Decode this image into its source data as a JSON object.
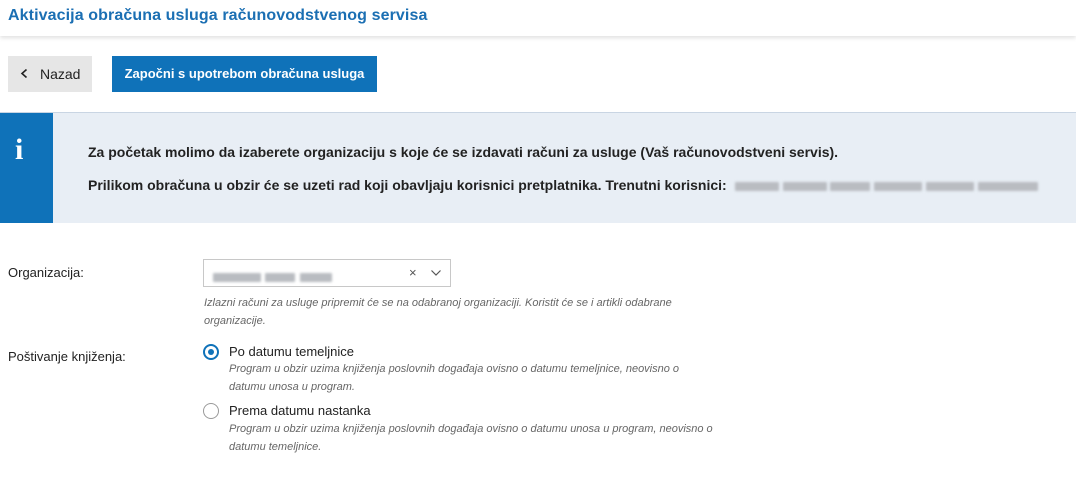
{
  "header": {
    "title": "Aktivacija obračuna usluga računovodstvenog servisa"
  },
  "toolbar": {
    "back_label": "Nazad",
    "start_label": "Započni s upotrebom obračuna usluga"
  },
  "info": {
    "icon": "info-icon",
    "glyph": "i",
    "line1": "Za početak molimo da izaberete organizaciju s koje će se izdavati računi za usluge (Vaš računovodstveni servis).",
    "line2_prefix": "Prilikom obračuna u obzir će se uzeti rad koji obavljaju korisnici pretplatnika. Trenutni korisnici:"
  },
  "form": {
    "organization_label": "Organizacija:",
    "organization_hint": "Izlazni računi za usluge pripremit će se na odabranoj organizaciji. Koristit će se i artikli odabrane organizacije.",
    "clear_glyph": "×",
    "posting_label": "Poštivanje knjiženja:",
    "options": [
      {
        "label": "Po datumu temeljnice",
        "hint": "Program u obzir uzima knjiženja poslovnih događaja ovisno o datumu temeljnice, neovisno o datumu unosa u program.",
        "selected": true
      },
      {
        "label": "Prema datumu nastanka",
        "hint": "Program u obzir uzima knjiženja poslovnih događaja ovisno o datumu unosa u program, neovisno o datumu temeljnice.",
        "selected": false
      }
    ]
  },
  "colors": {
    "primary": "#0f72b9",
    "title": "#1b6fb3",
    "info_bg": "#e8eef5"
  }
}
